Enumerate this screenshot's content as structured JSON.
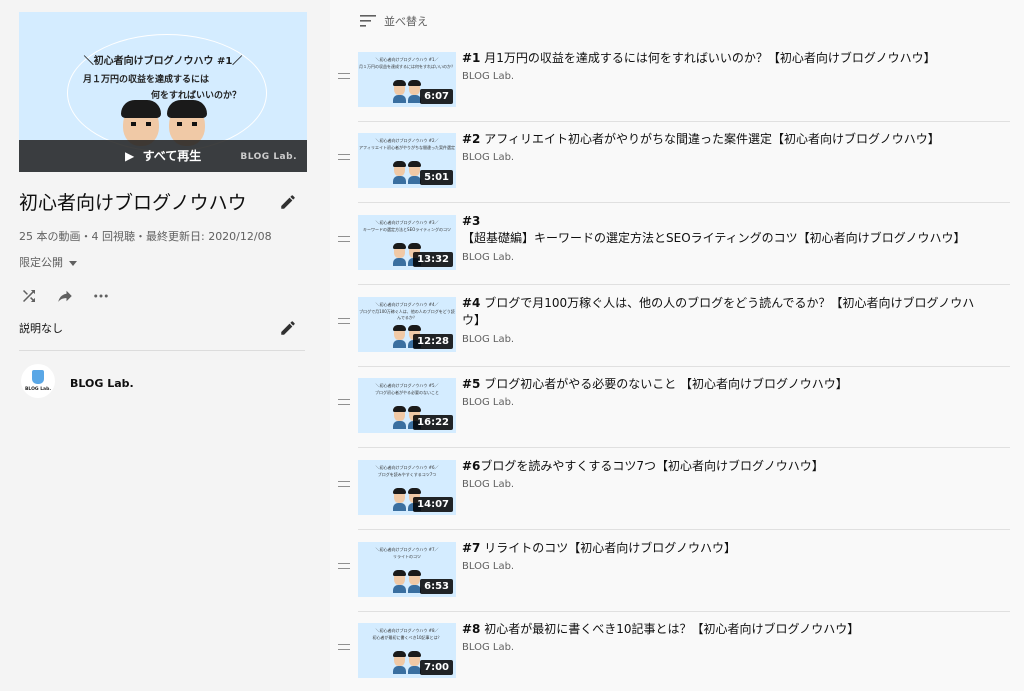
{
  "hero": {
    "line1": "＼初心者向けブログノウハウ #1／",
    "line2": "月１万円の収益を達成するには",
    "line3": "何をすればいいのか？",
    "play_all_label": "すべて再生",
    "watermark": "BLOG Lab."
  },
  "playlist": {
    "title": "初心者向けブログノウハウ",
    "stats": "25 本の動画・4 回視聴・最終更新日: 2020/12/08",
    "privacy": "限定公開",
    "description": "説明なし",
    "channel_name": "BLOG Lab.",
    "avatar_text": "BLOG Lab."
  },
  "sort": {
    "label": "並べ替え"
  },
  "videos": [
    {
      "num": "#1",
      "title": " 月1万円の収益を達成するには何をすればいいのか？【初心者向けブログノウハウ】",
      "channel": "BLOG Lab.",
      "duration": "6:07",
      "thumb1": "＼初心者向けブログノウハウ #1／",
      "thumb2": "月１万円の収益を達成するには何をすればいいのか？"
    },
    {
      "num": "#2",
      "title": " アフィリエイト初心者がやりがちな間違った案件選定【初心者向けブログノウハウ】",
      "channel": "BLOG Lab.",
      "duration": "5:01",
      "thumb1": "＼初心者向けブログノウハウ #2／",
      "thumb2": "アフィリエイト初心者がやりがちな間違った案件選定"
    },
    {
      "num": "#3",
      "title": " 【超基礎編】キーワードの選定方法とSEOライティングのコツ【初心者向けブログノウハウ】",
      "channel": "BLOG Lab.",
      "duration": "13:32",
      "thumb1": "＼初心者向けブログノウハウ #3／",
      "thumb2": "キーワードの選定方法とSEOライティングのコツ"
    },
    {
      "num": "#4",
      "title": " ブログで月100万稼ぐ人は、他の人のブログをどう読んでるか？【初心者向けブログノウハウ】",
      "channel": "BLOG Lab.",
      "duration": "12:28",
      "thumb1": "＼初心者向けブログノウハウ #4／",
      "thumb2": "ブログで月100万稼ぐ人は、他の人のブログをどう読んでるか？"
    },
    {
      "num": "#5",
      "title": " ブログ初心者がやる必要のないこと 【初心者向けブログノウハウ】",
      "channel": "BLOG Lab.",
      "duration": "16:22",
      "thumb1": "＼初心者向けブログノウハウ #5／",
      "thumb2": "ブログ初心者がやる必要のないこと"
    },
    {
      "num": "#6",
      "title": "ブログを読みやすくするコツ7つ【初心者向けブログノウハウ】",
      "channel": "BLOG Lab.",
      "duration": "14:07",
      "thumb1": "＼初心者向けブログノウハウ #6／",
      "thumb2": "ブログを読みやすくするコツ7つ"
    },
    {
      "num": "#7",
      "title": " リライトのコツ【初心者向けブログノウハウ】",
      "channel": "BLOG Lab.",
      "duration": "6:53",
      "thumb1": "＼初心者向けブログノウハウ #7／",
      "thumb2": "リライトのコツ"
    },
    {
      "num": "#8",
      "title": " 初心者が最初に書くべき10記事とは？【初心者向けブログノウハウ】",
      "channel": "BLOG Lab.",
      "duration": "7:00",
      "thumb1": "＼初心者向けブログノウハウ #8／",
      "thumb2": "初心者が最初に書くべき10記事とは？"
    }
  ],
  "icons": {
    "edit": "pencil-icon",
    "shuffle": "shuffle-icon",
    "share": "share-icon",
    "more": "more-horiz-icon",
    "sort": "sort-icon",
    "drag": "drag-handle-icon"
  }
}
